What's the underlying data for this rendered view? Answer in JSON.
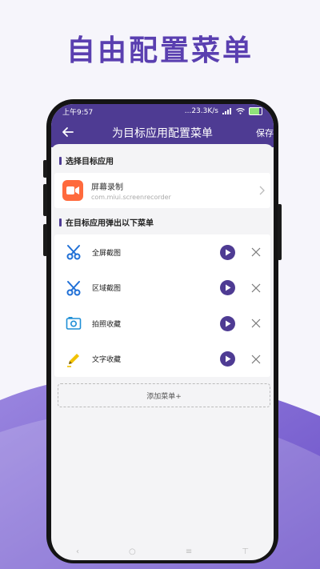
{
  "headline": "自由配置菜单",
  "status": {
    "time": "上午9:57",
    "speed": "...23.3K/s",
    "battery": "89"
  },
  "appbar": {
    "title": "为目标应用配置菜单",
    "save_label": "保存"
  },
  "section_target": {
    "label": "选择目标应用"
  },
  "target_app": {
    "name": "屏幕录制",
    "package": "com.miui.screenrecorder"
  },
  "section_menu": {
    "label": "在目标应用弹出以下菜单"
  },
  "menu_items": [
    {
      "label": "全屏截图",
      "icon": "scissors-icon"
    },
    {
      "label": "区域截图",
      "icon": "scissors-icon"
    },
    {
      "label": "拍照收藏",
      "icon": "camera-icon"
    },
    {
      "label": "文字收藏",
      "icon": "pencil-icon"
    }
  ],
  "add_button_label": "添加菜单+",
  "nav": {
    "back": "‹",
    "home": "○",
    "menu": "≡",
    "extra": "⊤"
  },
  "colors": {
    "primary": "#4e3b93",
    "headline": "#5a3fb0",
    "app_icon": "#ff6a3d"
  }
}
